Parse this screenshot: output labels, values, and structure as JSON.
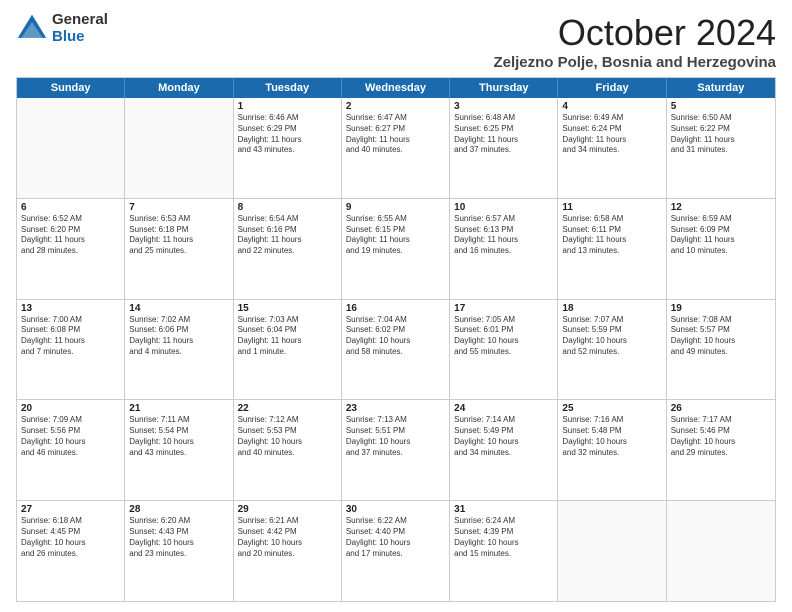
{
  "logo": {
    "general": "General",
    "blue": "Blue"
  },
  "header": {
    "month": "October 2024",
    "location": "Zeljezno Polje, Bosnia and Herzegovina"
  },
  "days": [
    "Sunday",
    "Monday",
    "Tuesday",
    "Wednesday",
    "Thursday",
    "Friday",
    "Saturday"
  ],
  "weeks": [
    [
      {
        "day": "",
        "lines": []
      },
      {
        "day": "",
        "lines": []
      },
      {
        "day": "1",
        "lines": [
          "Sunrise: 6:46 AM",
          "Sunset: 6:29 PM",
          "Daylight: 11 hours",
          "and 43 minutes."
        ]
      },
      {
        "day": "2",
        "lines": [
          "Sunrise: 6:47 AM",
          "Sunset: 6:27 PM",
          "Daylight: 11 hours",
          "and 40 minutes."
        ]
      },
      {
        "day": "3",
        "lines": [
          "Sunrise: 6:48 AM",
          "Sunset: 6:25 PM",
          "Daylight: 11 hours",
          "and 37 minutes."
        ]
      },
      {
        "day": "4",
        "lines": [
          "Sunrise: 6:49 AM",
          "Sunset: 6:24 PM",
          "Daylight: 11 hours",
          "and 34 minutes."
        ]
      },
      {
        "day": "5",
        "lines": [
          "Sunrise: 6:50 AM",
          "Sunset: 6:22 PM",
          "Daylight: 11 hours",
          "and 31 minutes."
        ]
      }
    ],
    [
      {
        "day": "6",
        "lines": [
          "Sunrise: 6:52 AM",
          "Sunset: 6:20 PM",
          "Daylight: 11 hours",
          "and 28 minutes."
        ]
      },
      {
        "day": "7",
        "lines": [
          "Sunrise: 6:53 AM",
          "Sunset: 6:18 PM",
          "Daylight: 11 hours",
          "and 25 minutes."
        ]
      },
      {
        "day": "8",
        "lines": [
          "Sunrise: 6:54 AM",
          "Sunset: 6:16 PM",
          "Daylight: 11 hours",
          "and 22 minutes."
        ]
      },
      {
        "day": "9",
        "lines": [
          "Sunrise: 6:55 AM",
          "Sunset: 6:15 PM",
          "Daylight: 11 hours",
          "and 19 minutes."
        ]
      },
      {
        "day": "10",
        "lines": [
          "Sunrise: 6:57 AM",
          "Sunset: 6:13 PM",
          "Daylight: 11 hours",
          "and 16 minutes."
        ]
      },
      {
        "day": "11",
        "lines": [
          "Sunrise: 6:58 AM",
          "Sunset: 6:11 PM",
          "Daylight: 11 hours",
          "and 13 minutes."
        ]
      },
      {
        "day": "12",
        "lines": [
          "Sunrise: 6:59 AM",
          "Sunset: 6:09 PM",
          "Daylight: 11 hours",
          "and 10 minutes."
        ]
      }
    ],
    [
      {
        "day": "13",
        "lines": [
          "Sunrise: 7:00 AM",
          "Sunset: 6:08 PM",
          "Daylight: 11 hours",
          "and 7 minutes."
        ]
      },
      {
        "day": "14",
        "lines": [
          "Sunrise: 7:02 AM",
          "Sunset: 6:06 PM",
          "Daylight: 11 hours",
          "and 4 minutes."
        ]
      },
      {
        "day": "15",
        "lines": [
          "Sunrise: 7:03 AM",
          "Sunset: 6:04 PM",
          "Daylight: 11 hours",
          "and 1 minute."
        ]
      },
      {
        "day": "16",
        "lines": [
          "Sunrise: 7:04 AM",
          "Sunset: 6:02 PM",
          "Daylight: 10 hours",
          "and 58 minutes."
        ]
      },
      {
        "day": "17",
        "lines": [
          "Sunrise: 7:05 AM",
          "Sunset: 6:01 PM",
          "Daylight: 10 hours",
          "and 55 minutes."
        ]
      },
      {
        "day": "18",
        "lines": [
          "Sunrise: 7:07 AM",
          "Sunset: 5:59 PM",
          "Daylight: 10 hours",
          "and 52 minutes."
        ]
      },
      {
        "day": "19",
        "lines": [
          "Sunrise: 7:08 AM",
          "Sunset: 5:57 PM",
          "Daylight: 10 hours",
          "and 49 minutes."
        ]
      }
    ],
    [
      {
        "day": "20",
        "lines": [
          "Sunrise: 7:09 AM",
          "Sunset: 5:56 PM",
          "Daylight: 10 hours",
          "and 46 minutes."
        ]
      },
      {
        "day": "21",
        "lines": [
          "Sunrise: 7:11 AM",
          "Sunset: 5:54 PM",
          "Daylight: 10 hours",
          "and 43 minutes."
        ]
      },
      {
        "day": "22",
        "lines": [
          "Sunrise: 7:12 AM",
          "Sunset: 5:53 PM",
          "Daylight: 10 hours",
          "and 40 minutes."
        ]
      },
      {
        "day": "23",
        "lines": [
          "Sunrise: 7:13 AM",
          "Sunset: 5:51 PM",
          "Daylight: 10 hours",
          "and 37 minutes."
        ]
      },
      {
        "day": "24",
        "lines": [
          "Sunrise: 7:14 AM",
          "Sunset: 5:49 PM",
          "Daylight: 10 hours",
          "and 34 minutes."
        ]
      },
      {
        "day": "25",
        "lines": [
          "Sunrise: 7:16 AM",
          "Sunset: 5:48 PM",
          "Daylight: 10 hours",
          "and 32 minutes."
        ]
      },
      {
        "day": "26",
        "lines": [
          "Sunrise: 7:17 AM",
          "Sunset: 5:46 PM",
          "Daylight: 10 hours",
          "and 29 minutes."
        ]
      }
    ],
    [
      {
        "day": "27",
        "lines": [
          "Sunrise: 6:18 AM",
          "Sunset: 4:45 PM",
          "Daylight: 10 hours",
          "and 26 minutes."
        ]
      },
      {
        "day": "28",
        "lines": [
          "Sunrise: 6:20 AM",
          "Sunset: 4:43 PM",
          "Daylight: 10 hours",
          "and 23 minutes."
        ]
      },
      {
        "day": "29",
        "lines": [
          "Sunrise: 6:21 AM",
          "Sunset: 4:42 PM",
          "Daylight: 10 hours",
          "and 20 minutes."
        ]
      },
      {
        "day": "30",
        "lines": [
          "Sunrise: 6:22 AM",
          "Sunset: 4:40 PM",
          "Daylight: 10 hours",
          "and 17 minutes."
        ]
      },
      {
        "day": "31",
        "lines": [
          "Sunrise: 6:24 AM",
          "Sunset: 4:39 PM",
          "Daylight: 10 hours",
          "and 15 minutes."
        ]
      },
      {
        "day": "",
        "lines": []
      },
      {
        "day": "",
        "lines": []
      }
    ]
  ]
}
